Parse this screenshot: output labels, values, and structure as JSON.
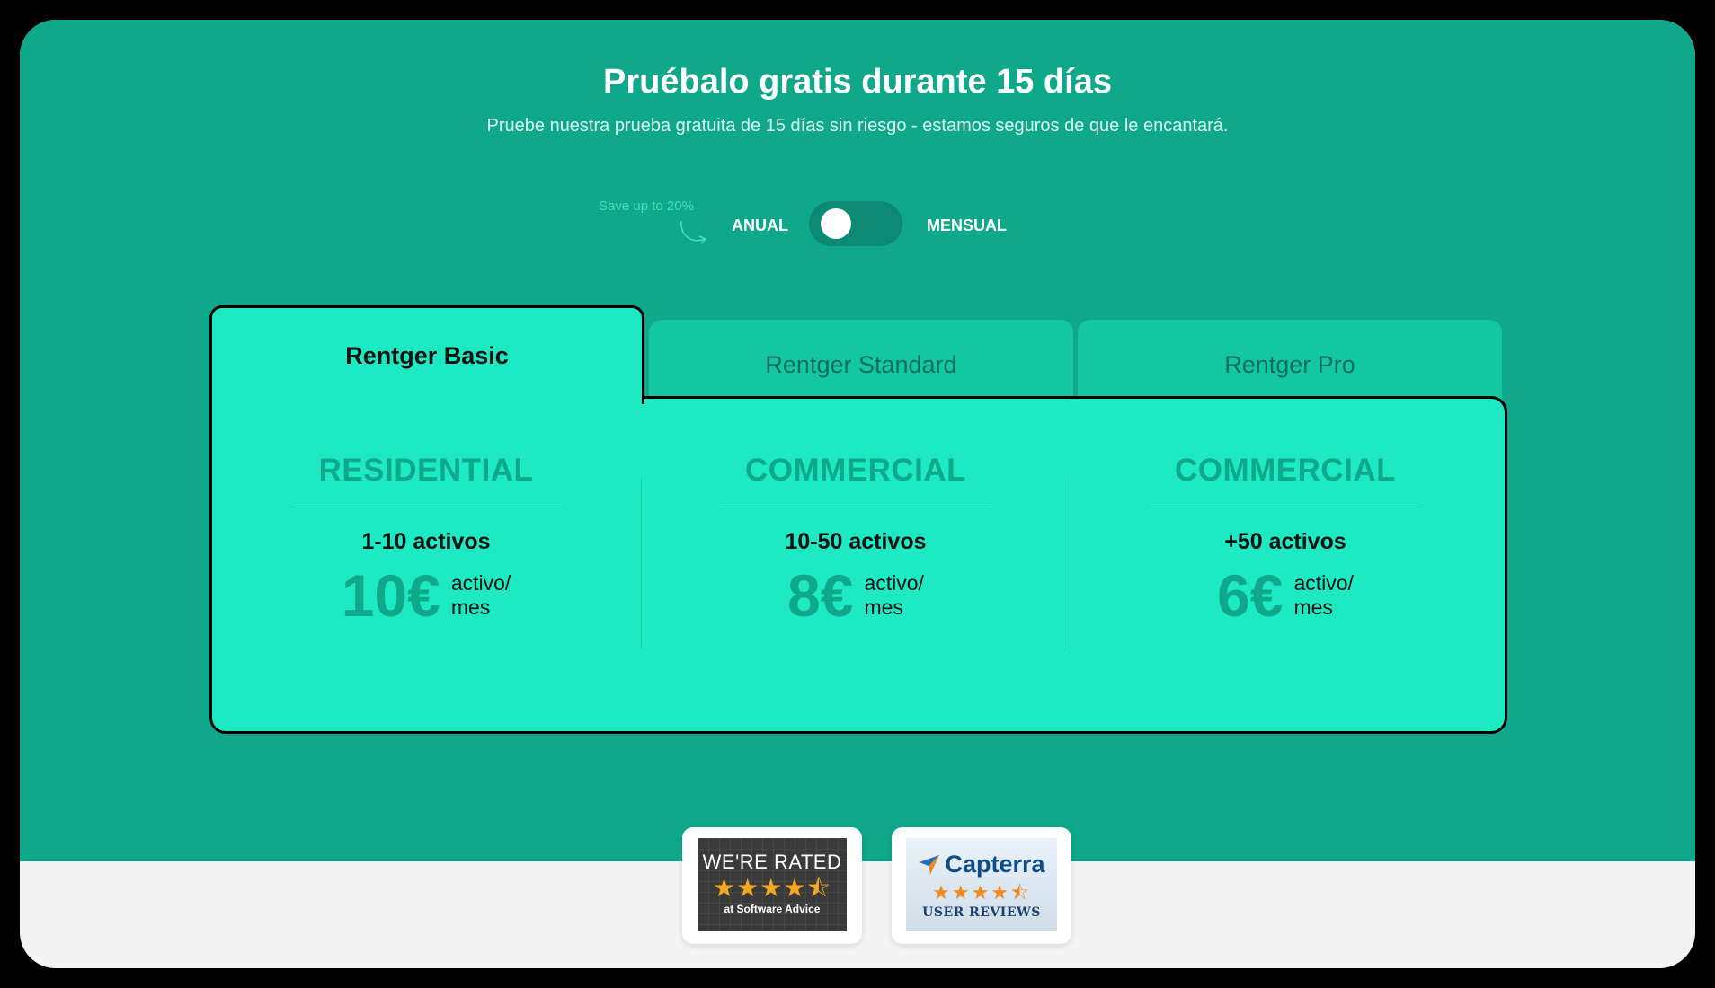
{
  "header": {
    "title": "Pruébalo gratis durante 15 días",
    "subtitle": "Pruebe nuestra prueba gratuita de 15 días sin riesgo - estamos seguros de que le encantará."
  },
  "billing": {
    "save_note": "Save up to 20%",
    "annual_label": "ANUAL",
    "monthly_label": "MENSUAL",
    "selected": "ANUAL"
  },
  "tabs": [
    {
      "label": "Rentger Basic",
      "active": true
    },
    {
      "label": "Rentger Standard",
      "active": false
    },
    {
      "label": "Rentger Pro",
      "active": false
    }
  ],
  "plans": [
    {
      "name": "RESIDENTIAL",
      "assets": "1-10 activos",
      "price": "10€",
      "unit_line1": "activo/",
      "unit_line2": "mes"
    },
    {
      "name": "COMMERCIAL",
      "assets": "10-50 activos",
      "price": "8€",
      "unit_line1": "activo/",
      "unit_line2": "mes"
    },
    {
      "name": "COMMERCIAL",
      "assets": "+50 activos",
      "price": "6€",
      "unit_line1": "activo/",
      "unit_line2": "mes"
    }
  ],
  "badges": {
    "software_advice": {
      "title": "WE'RE RATED",
      "stars": "★★★★⯪",
      "source": "at Software Advice"
    },
    "capterra": {
      "name": "Capterra",
      "stars": "★★★★⯪",
      "label": "USER REVIEWS"
    }
  },
  "colors": {
    "hero_background": "#0fa88b",
    "card_background": "#1de9c3",
    "inactive_tab": "#13c7a3",
    "price_accent": "#0fa88b",
    "footer_background": "#f4f4f4"
  }
}
